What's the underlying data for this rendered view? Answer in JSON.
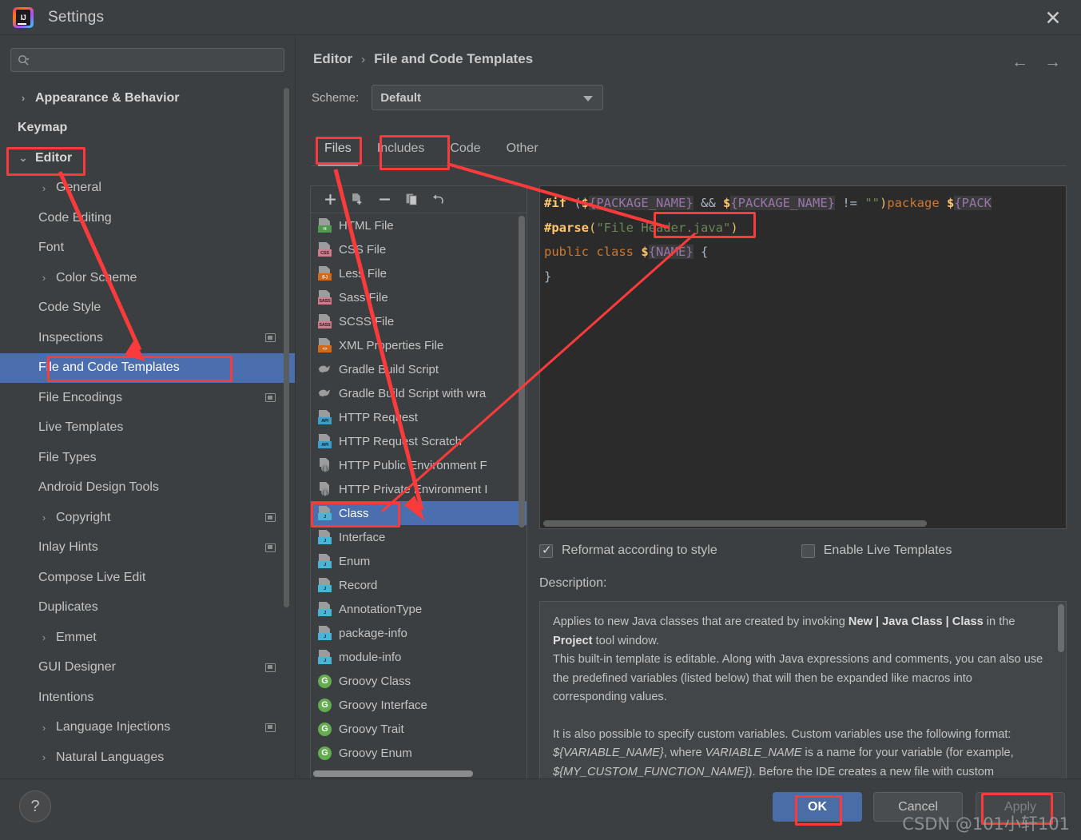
{
  "window": {
    "title": "Settings",
    "logo_text": "IJ",
    "close_icon": "✕"
  },
  "sidebar": {
    "search_placeholder": "",
    "search_value": "",
    "items": [
      {
        "label": "Appearance & Behavior",
        "level": 1,
        "arrow": "›",
        "bold": true,
        "badge": false,
        "selected": false
      },
      {
        "label": "Keymap",
        "level": 1,
        "arrow": "",
        "bold": true,
        "badge": false,
        "selected": false
      },
      {
        "label": "Editor",
        "level": 1,
        "arrow": "⌄",
        "bold": true,
        "badge": false,
        "selected": false
      },
      {
        "label": "General",
        "level": 2,
        "arrow": "›",
        "bold": false,
        "badge": false,
        "selected": false
      },
      {
        "label": "Code Editing",
        "level": 2,
        "arrow": "",
        "bold": false,
        "badge": false,
        "selected": false
      },
      {
        "label": "Font",
        "level": 2,
        "arrow": "",
        "bold": false,
        "badge": false,
        "selected": false
      },
      {
        "label": "Color Scheme",
        "level": 2,
        "arrow": "›",
        "bold": false,
        "badge": false,
        "selected": false
      },
      {
        "label": "Code Style",
        "level": 2,
        "arrow": "",
        "bold": false,
        "badge": false,
        "selected": false
      },
      {
        "label": "Inspections",
        "level": 2,
        "arrow": "",
        "bold": false,
        "badge": true,
        "selected": false
      },
      {
        "label": "File and Code Templates",
        "level": 2,
        "arrow": "",
        "bold": false,
        "badge": false,
        "selected": true
      },
      {
        "label": "File Encodings",
        "level": 2,
        "arrow": "",
        "bold": false,
        "badge": true,
        "selected": false
      },
      {
        "label": "Live Templates",
        "level": 2,
        "arrow": "",
        "bold": false,
        "badge": false,
        "selected": false
      },
      {
        "label": "File Types",
        "level": 2,
        "arrow": "",
        "bold": false,
        "badge": false,
        "selected": false
      },
      {
        "label": "Android Design Tools",
        "level": 2,
        "arrow": "",
        "bold": false,
        "badge": false,
        "selected": false
      },
      {
        "label": "Copyright",
        "level": 2,
        "arrow": "›",
        "bold": false,
        "badge": true,
        "selected": false
      },
      {
        "label": "Inlay Hints",
        "level": 2,
        "arrow": "",
        "bold": false,
        "badge": true,
        "selected": false
      },
      {
        "label": "Compose Live Edit",
        "level": 2,
        "arrow": "",
        "bold": false,
        "badge": false,
        "selected": false
      },
      {
        "label": "Duplicates",
        "level": 2,
        "arrow": "",
        "bold": false,
        "badge": false,
        "selected": false
      },
      {
        "label": "Emmet",
        "level": 2,
        "arrow": "›",
        "bold": false,
        "badge": false,
        "selected": false
      },
      {
        "label": "GUI Designer",
        "level": 2,
        "arrow": "",
        "bold": false,
        "badge": true,
        "selected": false
      },
      {
        "label": "Intentions",
        "level": 2,
        "arrow": "",
        "bold": false,
        "badge": false,
        "selected": false
      },
      {
        "label": "Language Injections",
        "level": 2,
        "arrow": "›",
        "bold": false,
        "badge": true,
        "selected": false
      },
      {
        "label": "Natural Languages",
        "level": 2,
        "arrow": "›",
        "bold": false,
        "badge": false,
        "selected": false
      }
    ]
  },
  "main": {
    "breadcrumb": {
      "parent": "Editor",
      "separator": "›",
      "current": "File and Code Templates"
    },
    "nav": {
      "back_icon": "←",
      "forward_icon": "→"
    },
    "scheme": {
      "label": "Scheme:",
      "value": "Default"
    },
    "tabs": [
      {
        "label": "Files",
        "active": true
      },
      {
        "label": "Includes",
        "active": false
      },
      {
        "label": "Code",
        "active": false
      },
      {
        "label": "Other",
        "active": false
      }
    ],
    "toolbar": [
      {
        "name": "add-template-button",
        "glyph": "+"
      },
      {
        "name": "create-from-file-button",
        "glyph": "file-plus"
      },
      {
        "name": "remove-template-button",
        "glyph": "−"
      },
      {
        "name": "copy-template-button",
        "glyph": "copy"
      },
      {
        "name": "reset-template-button",
        "glyph": "↶"
      }
    ],
    "templates": [
      {
        "label": "HTML File",
        "icon": "file",
        "tag": "H",
        "tag_color": "#4e9a4e",
        "tag_text_color": "#eaf4ea",
        "selected": false
      },
      {
        "label": "CSS File",
        "icon": "file",
        "tag": "CSS",
        "tag_color": "#cf7d8c",
        "tag_text_color": "#3a2026",
        "selected": false
      },
      {
        "label": "Less File",
        "icon": "file",
        "tag": "{L}",
        "tag_color": "#cf6a1c",
        "tag_text_color": "#f7e9dc",
        "selected": false
      },
      {
        "label": "Sass File",
        "icon": "file",
        "tag": "SASS",
        "tag_color": "#cf7d8c",
        "tag_text_color": "#3a2026",
        "selected": false
      },
      {
        "label": "SCSS File",
        "icon": "file",
        "tag": "SASS",
        "tag_color": "#cf7d8c",
        "tag_text_color": "#3a2026",
        "selected": false
      },
      {
        "label": "XML Properties File",
        "icon": "file",
        "tag": "<>",
        "tag_color": "#cf6a1c",
        "tag_text_color": "#f7e9dc",
        "selected": false
      },
      {
        "label": "Gradle Build Script",
        "icon": "gradle",
        "tag": "",
        "tag_color": "",
        "tag_text_color": "",
        "selected": false
      },
      {
        "label": "Gradle Build Script with wra",
        "icon": "gradle",
        "tag": "",
        "tag_color": "",
        "tag_text_color": "",
        "selected": false
      },
      {
        "label": "HTTP Request",
        "icon": "file",
        "tag": "API",
        "tag_color": "#3d9ecb",
        "tag_text_color": "#102030",
        "selected": false
      },
      {
        "label": "HTTP Request Scratch",
        "icon": "file",
        "tag": "API",
        "tag_color": "#3d9ecb",
        "tag_text_color": "#102030",
        "selected": false
      },
      {
        "label": "HTTP Public Environment F",
        "icon": "env",
        "tag": "{}",
        "tag_color": "",
        "tag_text_color": "",
        "selected": false
      },
      {
        "label": "HTTP Private Environment I",
        "icon": "env",
        "tag": "{}",
        "tag_color": "",
        "tag_text_color": "",
        "selected": false
      },
      {
        "label": "Class",
        "icon": "file",
        "tag": "J",
        "tag_color": "#4ab3d6",
        "tag_text_color": "#0f2833",
        "selected": true
      },
      {
        "label": "Interface",
        "icon": "file",
        "tag": "J",
        "tag_color": "#4ab3d6",
        "tag_text_color": "#0f2833",
        "selected": false
      },
      {
        "label": "Enum",
        "icon": "file",
        "tag": "J",
        "tag_color": "#4ab3d6",
        "tag_text_color": "#0f2833",
        "selected": false
      },
      {
        "label": "Record",
        "icon": "file",
        "tag": "J",
        "tag_color": "#4ab3d6",
        "tag_text_color": "#0f2833",
        "selected": false
      },
      {
        "label": "AnnotationType",
        "icon": "file",
        "tag": "J",
        "tag_color": "#4ab3d6",
        "tag_text_color": "#0f2833",
        "selected": false
      },
      {
        "label": "package-info",
        "icon": "file",
        "tag": "J",
        "tag_color": "#4ab3d6",
        "tag_text_color": "#0f2833",
        "selected": false
      },
      {
        "label": "module-info",
        "icon": "file",
        "tag": "J",
        "tag_color": "#4ab3d6",
        "tag_text_color": "#0f2833",
        "selected": false
      },
      {
        "label": "Groovy Class",
        "icon": "groovy",
        "tag": "G",
        "tag_color": "#63ad4f",
        "tag_text_color": "#ffffff",
        "selected": false
      },
      {
        "label": "Groovy Interface",
        "icon": "groovy",
        "tag": "G",
        "tag_color": "#63ad4f",
        "tag_text_color": "#ffffff",
        "selected": false
      },
      {
        "label": "Groovy Trait",
        "icon": "groovy",
        "tag": "G",
        "tag_color": "#63ad4f",
        "tag_text_color": "#ffffff",
        "selected": false
      },
      {
        "label": "Groovy Enum",
        "icon": "groovy",
        "tag": "G",
        "tag_color": "#63ad4f",
        "tag_text_color": "#ffffff",
        "selected": false
      }
    ],
    "editor_code": {
      "line1_directive": "#if",
      "line1_rest": " (${PACKAGE_NAME} && ${PACKAGE_NAME} != \"\")package ${PACK",
      "line2": "#parse(\"File Header.java\")",
      "line3": "public class ${NAME} {",
      "line4": "}"
    },
    "checkboxes": [
      {
        "label": "Reformat according to style",
        "checked": true
      },
      {
        "label": "Enable Live Templates",
        "checked": false
      }
    ],
    "description_label": "Description:",
    "description_paragraphs": [
      "Applies to new Java classes that are created by invoking New | Java Class | Class in the Project tool window.",
      "This built-in template is editable. Along with Java expressions and comments, you can also use the predefined variables (listed below) that will then be expanded like macros into corresponding values.",
      "It is also possible to specify custom variables. Custom variables use the following format: ${VARIABLE_NAME}, where VARIABLE_NAME is a name for your variable (for example, ${MY_CUSTOM_FUNCTION_NAME}). Before the IDE creates a new file with custom variables, you see a dialog where you can define values for custom variables in the template."
    ]
  },
  "footer": {
    "help_label": "?",
    "ok_label": "OK",
    "cancel_label": "Cancel",
    "apply_label": "Apply"
  },
  "watermark": "CSDN @101小轩101",
  "annotation_color": "#fb3b3b"
}
